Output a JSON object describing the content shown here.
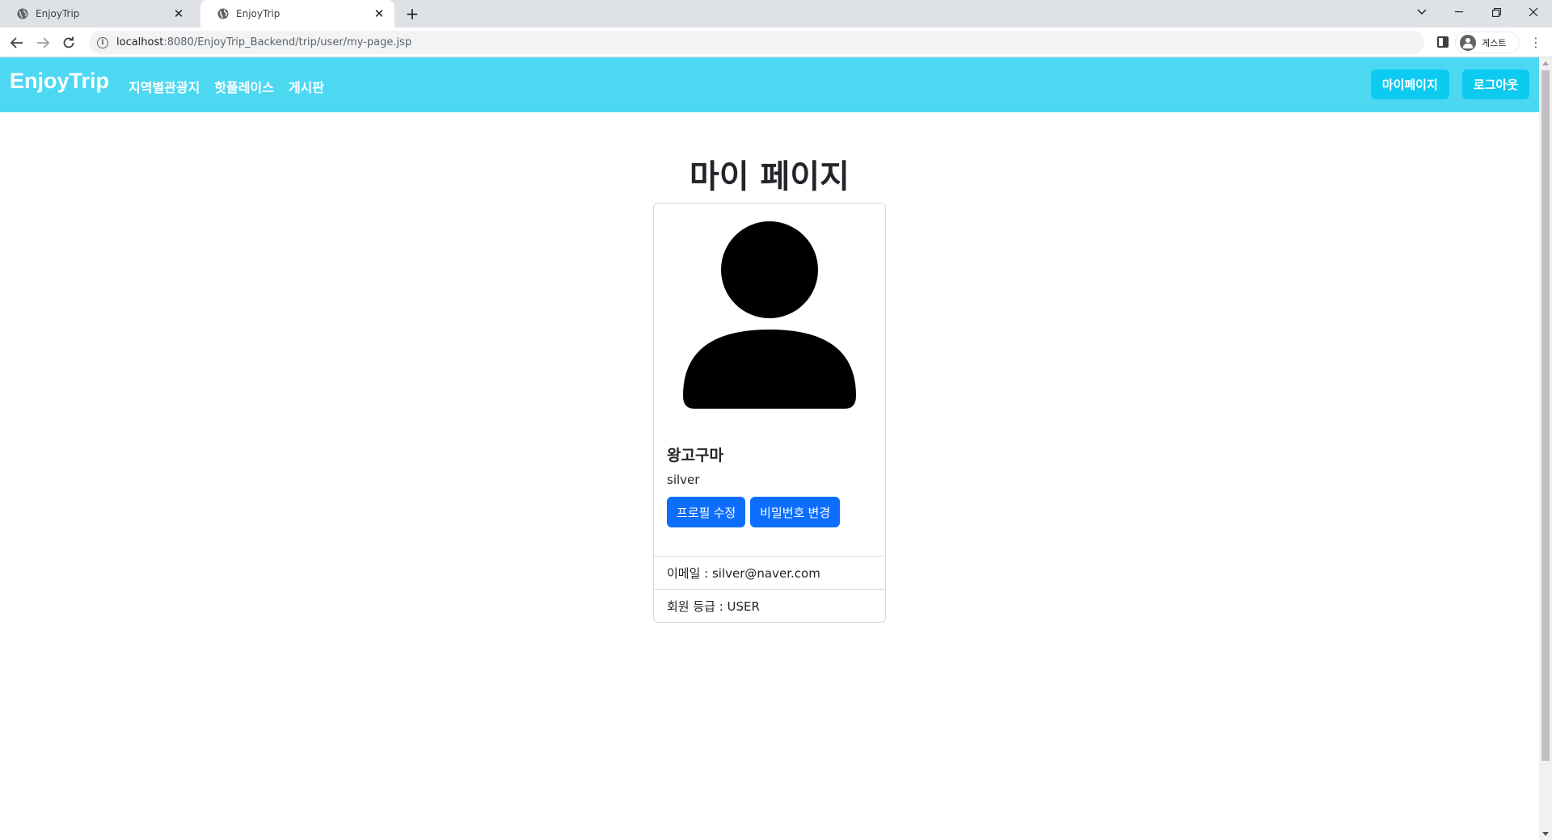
{
  "browser": {
    "tabs": [
      {
        "title": "EnjoyTrip",
        "active": false
      },
      {
        "title": "EnjoyTrip",
        "active": true
      }
    ],
    "url_host": "localhost",
    "url_path": ":8080/EnjoyTrip_Backend/trip/user/my-page.jsp",
    "profile_label": "게스트"
  },
  "navbar": {
    "brand": "EnjoyTrip",
    "links": [
      "지역별관광지",
      "핫플레이스",
      "게시판"
    ],
    "actions": [
      "마이페이지",
      "로그아웃"
    ],
    "bg_color": "#4dd8f2",
    "action_color": "#0dcaf0"
  },
  "page": {
    "title": "마이 페이지"
  },
  "profile": {
    "name": "왕고구마",
    "grade": "silver",
    "buttons": {
      "edit_profile": "프로필 수정",
      "change_password": "비밀번호 변경"
    },
    "details": [
      "이메일 : silver@naver.com",
      "회원 등급 : USER"
    ],
    "button_color": "#0d6efd"
  }
}
